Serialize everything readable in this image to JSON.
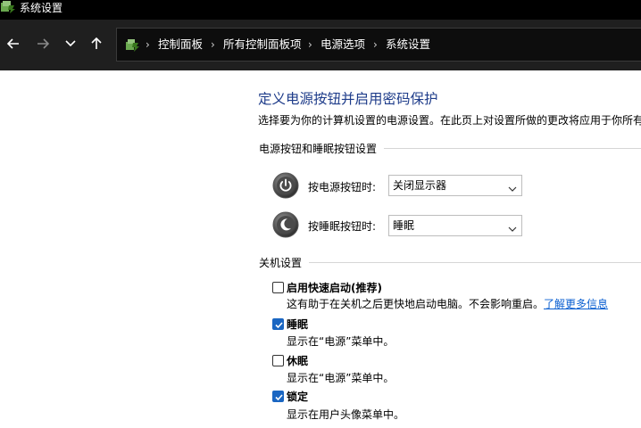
{
  "window": {
    "title": "系统设置",
    "app_icon": "power-options-icon"
  },
  "nav": {
    "back_icon": "arrow-left-icon",
    "forward_icon": "arrow-right-icon",
    "recent_icon": "chevron-down-icon",
    "up_icon": "arrow-up-icon",
    "breadcrumb": [
      "控制面板",
      "所有控制面板项",
      "电源选项",
      "系统设置"
    ]
  },
  "page": {
    "title": "定义电源按钮并启用密码保护",
    "description": "选择要为你的计算机设置的电源设置。在此页上对设置所做的更改将应用于你所有"
  },
  "buttons_section": {
    "header": "电源按钮和睡眠按钮设置",
    "rows": [
      {
        "label": "按电源按钮时:",
        "value": "关闭显示器",
        "icon": "power-button-icon"
      },
      {
        "label": "按睡眠按钮时:",
        "value": "睡眠",
        "icon": "sleep-button-icon"
      }
    ]
  },
  "shutdown_section": {
    "header": "关机设置",
    "options": [
      {
        "label": "启用快速启动(推荐)",
        "checked": false,
        "description": "这有助于在关机之后更快地启动电脑。不会影响重启。",
        "link": "了解更多信息"
      },
      {
        "label": "睡眠",
        "checked": true,
        "description": "显示在“电源”菜单中。"
      },
      {
        "label": "休眠",
        "checked": false,
        "description": "显示在“电源”菜单中。"
      },
      {
        "label": "锁定",
        "checked": true,
        "description": "显示在用户头像菜单中。"
      }
    ]
  },
  "colors": {
    "title_blue": "#1e3c8a",
    "link_blue": "#0a5fd1",
    "check_blue": "#1a66c2"
  }
}
